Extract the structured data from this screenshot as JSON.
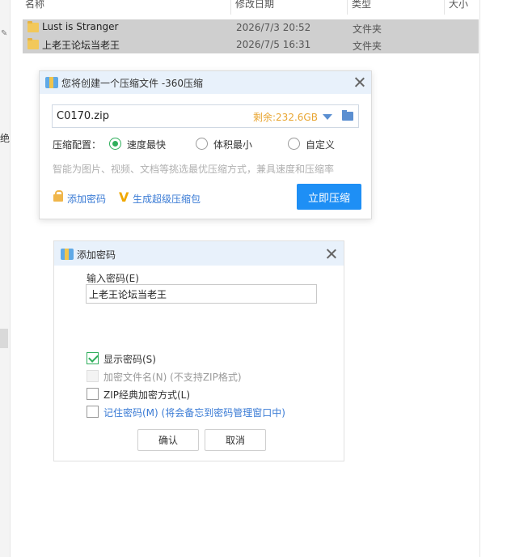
{
  "explorer": {
    "columns": {
      "name": "名称",
      "date": "修改日期",
      "type": "类型",
      "size": "大小"
    },
    "left_marks": {
      "jue": "绝"
    },
    "files": [
      {
        "name": "Lust is Stranger",
        "date": "2026/7/3 20:52",
        "type": "文件夹"
      },
      {
        "name": "上老王论坛当老王",
        "date": "2026/7/5 16:31",
        "type": "文件夹"
      }
    ]
  },
  "compress_dialog": {
    "title": "您将创建一个压缩文件 -360压缩",
    "path_value": "C0170.zip",
    "free_space": "剩余:232.6GB",
    "config_label": "压缩配置：",
    "options": [
      {
        "label": "速度最快",
        "checked": true
      },
      {
        "label": "体积最小",
        "checked": false
      },
      {
        "label": "自定义",
        "checked": false
      }
    ],
    "hint": "智能为图片、视频、文档等挑选最优压缩方式，兼具速度和压缩率",
    "add_password_link": "添加密码",
    "super_link": "生成超级压缩包",
    "compress_button": "立即压缩"
  },
  "password_dialog": {
    "title": "添加密码",
    "input_label": "输入密码(E)",
    "password_value": "上老王论坛当老王",
    "checkboxes": {
      "show_password": {
        "label": "显示密码(S)",
        "checked": true
      },
      "encrypt_filenames": {
        "label": "加密文件名(N)  (不支持ZIP格式)",
        "checked": false,
        "disabled": true
      },
      "zip_classic": {
        "label": "ZIP经典加密方式(L)",
        "checked": false
      },
      "remember_password": {
        "label": "记住密码(M)  (将会备忘到密码管理窗口中)",
        "checked": false
      }
    },
    "ok_button": "确认",
    "cancel_button": "取消"
  },
  "colors": {
    "accent_blue": "#1e8ff5",
    "link_blue": "#3a7bd5",
    "check_green": "#2fae5b",
    "free_space_orange": "#e8a531"
  }
}
